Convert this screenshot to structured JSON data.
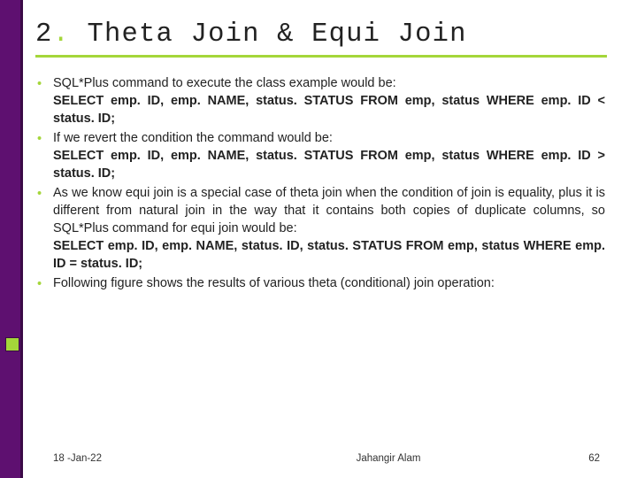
{
  "title": {
    "number": "2",
    "text": "Theta Join & Equi Join"
  },
  "bullets": [
    {
      "intro": "SQL*Plus command to execute the class example would be:",
      "code": "SELECT emp. ID, emp. NAME, status. STATUS FROM emp, status WHERE emp. ID < status. ID;"
    },
    {
      "intro": "If we revert the condition the command would be:",
      "code": "SELECT emp. ID, emp. NAME, status. STATUS FROM emp, status WHERE emp. ID > status. ID;"
    },
    {
      "intro": "As we know equi join is a special case of theta join when the condition of join is equality, plus it is different from natural join in the way that it contains both copies of duplicate columns, so SQL*Plus command for equi join would be:",
      "code": "SELECT emp. ID, emp. NAME, status. ID, status. STATUS FROM emp, status WHERE emp. ID = status. ID;"
    },
    {
      "intro": "Following figure shows the results of various theta (conditional)  join operation:",
      "code": ""
    }
  ],
  "footer": {
    "date": "18 -Jan-22",
    "author": "Jahangir Alam",
    "page": "62"
  }
}
